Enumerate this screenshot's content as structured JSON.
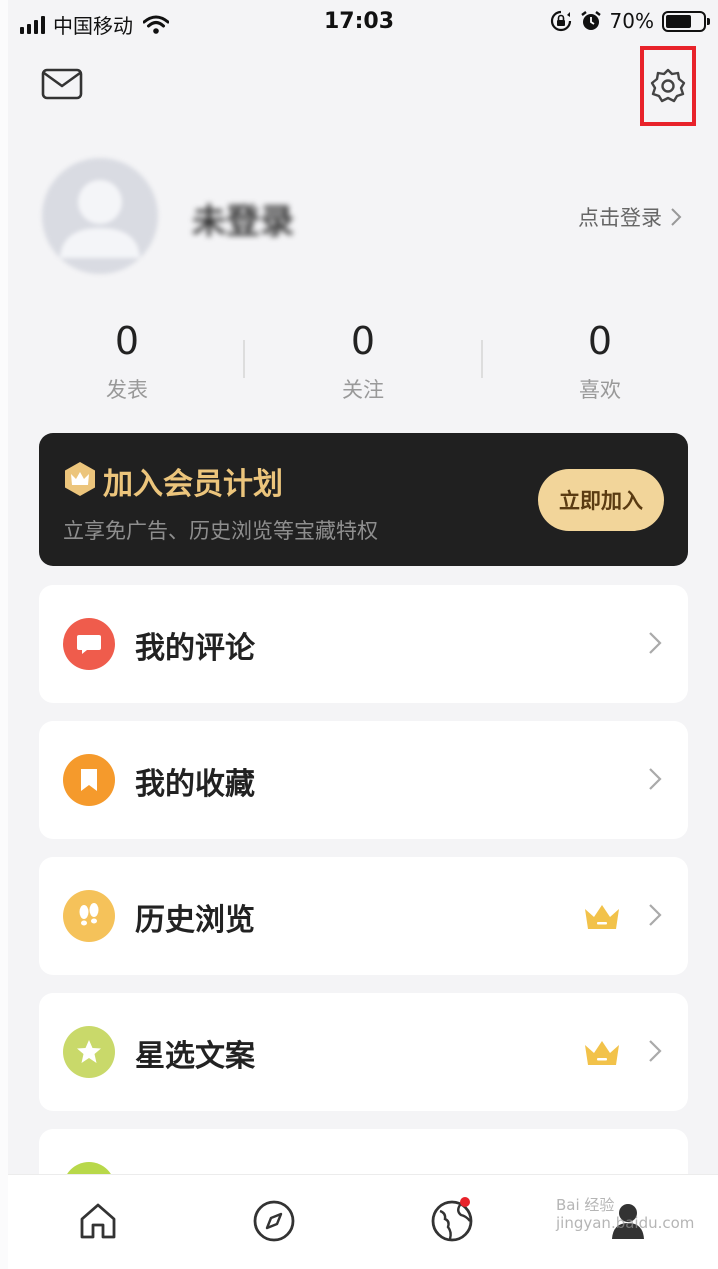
{
  "status_bar": {
    "carrier": "中国移动",
    "time": "17:03",
    "battery": "70%",
    "battery_level": 0.7
  },
  "header": {
    "mail_icon": "mail-icon",
    "settings_icon": "gear-icon"
  },
  "profile": {
    "name": "未登录",
    "login_link": "点击登录"
  },
  "stats": [
    {
      "value": "0",
      "label": "发表"
    },
    {
      "value": "0",
      "label": "关注"
    },
    {
      "value": "0",
      "label": "喜欢"
    }
  ],
  "vip": {
    "title": "加入会员计划",
    "subtitle": "立享免广告、历史浏览等宝藏特权",
    "button": "立即加入",
    "accent": "#ecc57c"
  },
  "menu": [
    {
      "label": "我的评论",
      "icon": "comment-icon",
      "color": "#ef5c4c",
      "vip": false
    },
    {
      "label": "我的收藏",
      "icon": "bookmark-icon",
      "color": "#f59a2c",
      "vip": false
    },
    {
      "label": "历史浏览",
      "icon": "footprints-icon",
      "color": "#f5c25a",
      "vip": true
    },
    {
      "label": "星选文案",
      "icon": "star-icon",
      "color": "#c9d96a",
      "vip": true
    }
  ],
  "tabs": [
    {
      "name": "home",
      "icon": "home-icon"
    },
    {
      "name": "discover",
      "icon": "compass-icon"
    },
    {
      "name": "world",
      "icon": "globe-icon",
      "badge": true
    },
    {
      "name": "me",
      "icon": "user-icon"
    }
  ],
  "watermark": {
    "line1": "Bai 经验",
    "line2": "jingyan.baidu.com"
  }
}
